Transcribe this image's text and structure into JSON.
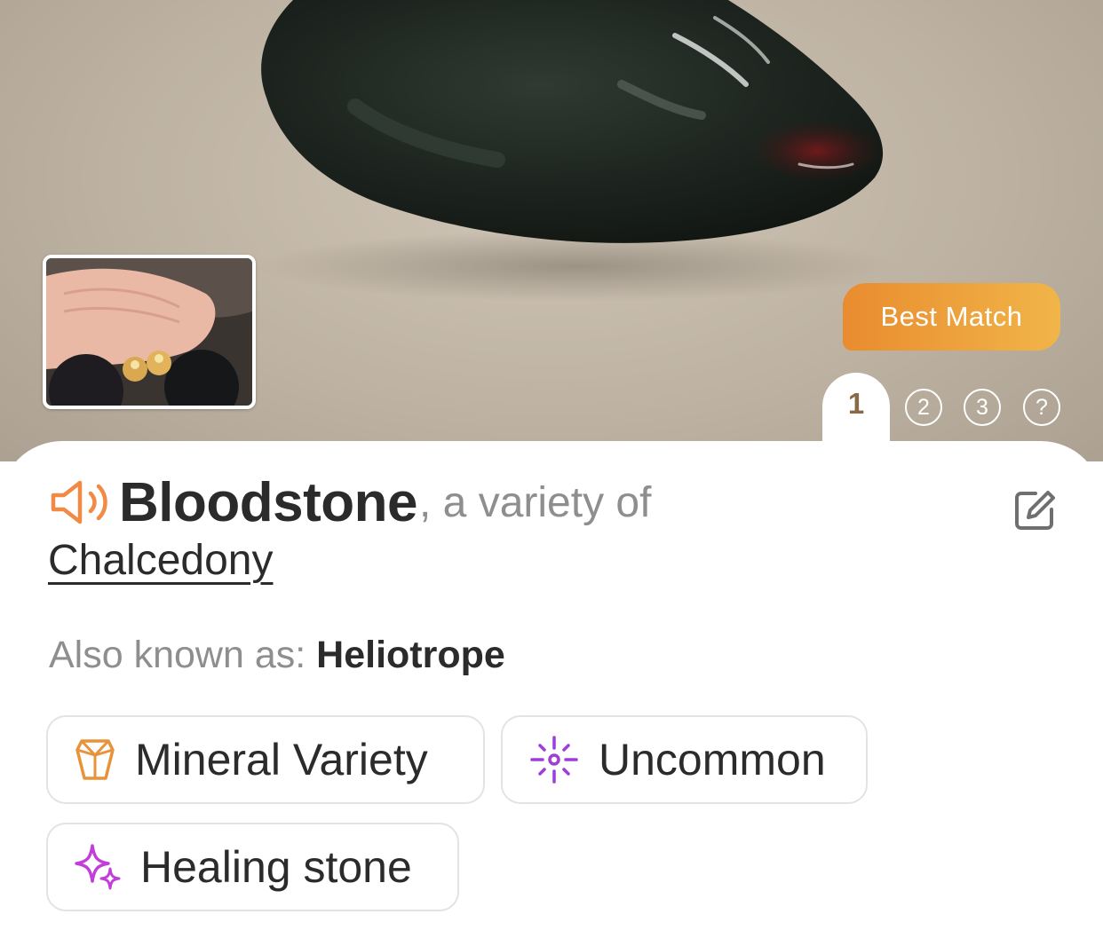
{
  "hero": {
    "badge_label": "Best Match",
    "pages": [
      "1",
      "2",
      "3",
      "?"
    ],
    "active_page": "1"
  },
  "identification": {
    "name": "Bloodstone",
    "relation_text": ", a variety of",
    "parent_name": "Chalcedony",
    "aka_label": "Also known as: ",
    "aka_value": "Heliotrope"
  },
  "tags": [
    {
      "label": "Mineral Variety",
      "icon": "crystal-icon",
      "color": "#e8923a"
    },
    {
      "label": "Uncommon",
      "icon": "sparkle-burst-icon",
      "color": "#9b3fd6"
    },
    {
      "label": "Healing stone",
      "icon": "sparkles-icon",
      "color": "#c13fd8"
    }
  ],
  "colors": {
    "accent_orange": "#e98c2f",
    "speaker_orange": "#f08a45",
    "text_dark": "#2b2b2b",
    "text_muted": "#8e8e8e"
  }
}
